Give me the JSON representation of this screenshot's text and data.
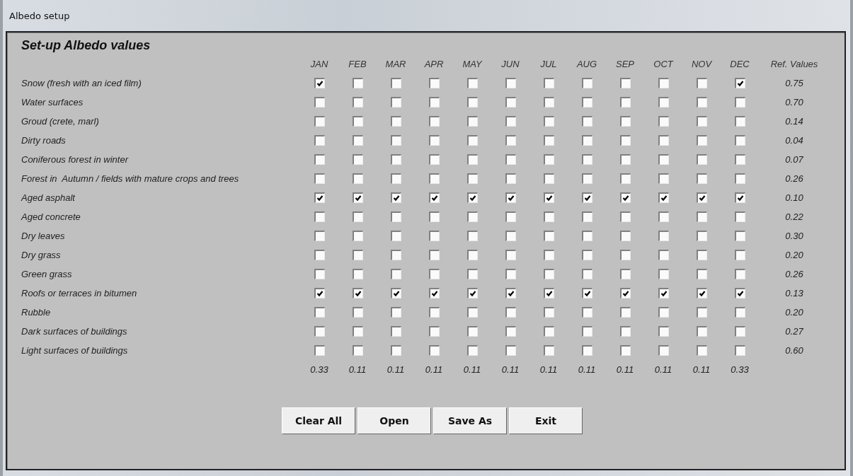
{
  "window": {
    "title": "Albedo setup"
  },
  "heading": "Set-up Albedo values",
  "columns": {
    "months": [
      "JAN",
      "FEB",
      "MAR",
      "APR",
      "MAY",
      "JUN",
      "JUL",
      "AUG",
      "SEP",
      "OCT",
      "NOV",
      "DEC"
    ],
    "reference": "Ref. Values"
  },
  "rows": [
    {
      "surface": "Snow (fresh with an iced film)",
      "checked": [
        true,
        false,
        false,
        false,
        false,
        false,
        false,
        false,
        false,
        false,
        false,
        true
      ],
      "reference": "0.75"
    },
    {
      "surface": "Water surfaces",
      "checked": [
        false,
        false,
        false,
        false,
        false,
        false,
        false,
        false,
        false,
        false,
        false,
        false
      ],
      "reference": "0.70"
    },
    {
      "surface": "Groud (crete, marl)",
      "checked": [
        false,
        false,
        false,
        false,
        false,
        false,
        false,
        false,
        false,
        false,
        false,
        false
      ],
      "reference": "0.14"
    },
    {
      "surface": "Dirty roads",
      "checked": [
        false,
        false,
        false,
        false,
        false,
        false,
        false,
        false,
        false,
        false,
        false,
        false
      ],
      "reference": "0.04"
    },
    {
      "surface": "Coniferous forest in winter",
      "checked": [
        false,
        false,
        false,
        false,
        false,
        false,
        false,
        false,
        false,
        false,
        false,
        false
      ],
      "reference": "0.07"
    },
    {
      "surface": "Forest in  Autumn / fields with mature crops and trees",
      "checked": [
        false,
        false,
        false,
        false,
        false,
        false,
        false,
        false,
        false,
        false,
        false,
        false
      ],
      "reference": "0.26"
    },
    {
      "surface": "Aged asphalt",
      "checked": [
        true,
        true,
        true,
        true,
        true,
        true,
        true,
        true,
        true,
        true,
        true,
        true
      ],
      "reference": "0.10"
    },
    {
      "surface": "Aged concrete",
      "checked": [
        false,
        false,
        false,
        false,
        false,
        false,
        false,
        false,
        false,
        false,
        false,
        false
      ],
      "reference": "0.22"
    },
    {
      "surface": "Dry leaves",
      "checked": [
        false,
        false,
        false,
        false,
        false,
        false,
        false,
        false,
        false,
        false,
        false,
        false
      ],
      "reference": "0.30"
    },
    {
      "surface": "Dry grass",
      "checked": [
        false,
        false,
        false,
        false,
        false,
        false,
        false,
        false,
        false,
        false,
        false,
        false
      ],
      "reference": "0.20"
    },
    {
      "surface": "Green grass",
      "checked": [
        false,
        false,
        false,
        false,
        false,
        false,
        false,
        false,
        false,
        false,
        false,
        false
      ],
      "reference": "0.26"
    },
    {
      "surface": "Roofs or terraces in bitumen",
      "checked": [
        true,
        true,
        true,
        true,
        true,
        true,
        true,
        true,
        true,
        true,
        true,
        true
      ],
      "reference": "0.13"
    },
    {
      "surface": "Rubble",
      "checked": [
        false,
        false,
        false,
        false,
        false,
        false,
        false,
        false,
        false,
        false,
        false,
        false
      ],
      "reference": "0.20"
    },
    {
      "surface": "Dark surfaces of buildings",
      "checked": [
        false,
        false,
        false,
        false,
        false,
        false,
        false,
        false,
        false,
        false,
        false,
        false
      ],
      "reference": "0.27"
    },
    {
      "surface": "Light surfaces of buildings",
      "checked": [
        false,
        false,
        false,
        false,
        false,
        false,
        false,
        false,
        false,
        false,
        false,
        false
      ],
      "reference": "0.60"
    }
  ],
  "totals": [
    "0.33",
    "0.11",
    "0.11",
    "0.11",
    "0.11",
    "0.11",
    "0.11",
    "0.11",
    "0.11",
    "0.11",
    "0.11",
    "0.33"
  ],
  "buttons": [
    "Clear All",
    "Open",
    "Save As",
    "Exit"
  ]
}
